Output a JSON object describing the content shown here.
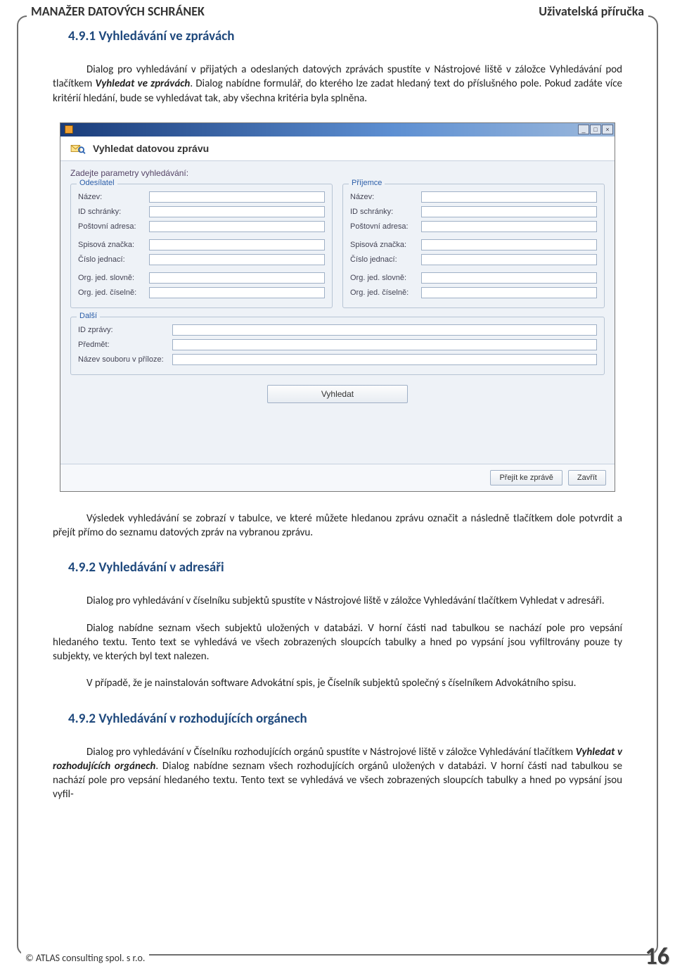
{
  "header": {
    "left": "MANAŽER DATOVÝCH SCHRÁNEK",
    "right": "Uživatelská příručka"
  },
  "sections": {
    "s1_title": "4.9.1 Vyhledávání ve zprávách",
    "s1_p1a": "Dialog pro vyhledávání v přijatých a odeslaných datových zprávách spustíte v Nástrojové liště v záložce Vyhledávání pod tlačítkem ",
    "s1_p1_bold": "Vyhledat ve zprávách",
    "s1_p1b": ". Dialog nabídne formulář, do kterého lze zadat hledaný text do příslušného pole. Pokud zadáte více kritérií hledání, bude se vyhledávat tak, aby všechna kritéria byla splněna.",
    "s1_p2": "Výsledek vyhledávání se zobrazí v tabulce, ve které můžete hledanou zprávu označit a následně tlačítkem dole potvrdit a přejít přímo do seznamu datových zpráv na vybranou zprávu.",
    "s2_title": "4.9.2 Vyhledávání v adresáři",
    "s2_p1": "Dialog pro vyhledávání v číselníku subjektů spustíte v Nástrojové liště v záložce Vyhledávání tlačítkem Vyhledat v adresáři.",
    "s2_p2": "Dialog nabídne seznam všech subjektů uložených v databázi. V horní části nad tabulkou se nachází pole pro vepsání hledaného textu. Tento text se vyhledává ve všech zobrazených sloupcích tabulky a hned po vypsání jsou vyfiltrovány pouze ty subjekty, ve kterých byl text nalezen.",
    "s2_p3": "V případě, že je nainstalován software Advokátní spis, je Číselník subjektů společný s číselníkem Advokátního spisu.",
    "s3_title": "4.9.2 Vyhledávání v rozhodujících orgánech",
    "s3_p1a": "Dialog pro vyhledávání v Číselníku rozhodujících orgánů spustíte v Nástrojové liště v záložce Vyhledávání tlačítkem ",
    "s3_p1_bold": "Vyhledat v rozhodujících orgánech",
    "s3_p1b": ". Dialog nabídne seznam všech rozhodujících orgánů uložených v databázi. V horní části nad tabulkou se nachází pole pro vepsání hledaného textu. Tento text se vyhledává ve všech zobrazených sloupcích tabulky a hned po vypsání jsou vyfil-"
  },
  "window": {
    "heading": "Vyhledat datovou zprávu",
    "params_label": "Zadejte parametry vyhledávání:",
    "group_sender": "Odesílatel",
    "group_recipient": "Příjemce",
    "labels": {
      "nazev": "Název:",
      "id_schranky": "ID schránky:",
      "postovni_adresa": "Poštovní adresa:",
      "spisova_znacka": "Spisová značka:",
      "cislo_jednaci": "Číslo jednací:",
      "org_slovne": "Org. jed. slovně:",
      "org_ciselne": "Org. jed. číselně:"
    },
    "group_other": "Další",
    "other": {
      "id_zpravy": "ID zprávy:",
      "predmet": "Předmět:",
      "nazev_souboru": "Název souboru v příloze:"
    },
    "search_btn": "Vyhledat",
    "footer": {
      "goto": "Přejít ke zprávě",
      "close": "Zavřít"
    }
  },
  "footer": {
    "copyright": "© ATLAS consulting spol. s r.o.",
    "page_number": "16"
  }
}
